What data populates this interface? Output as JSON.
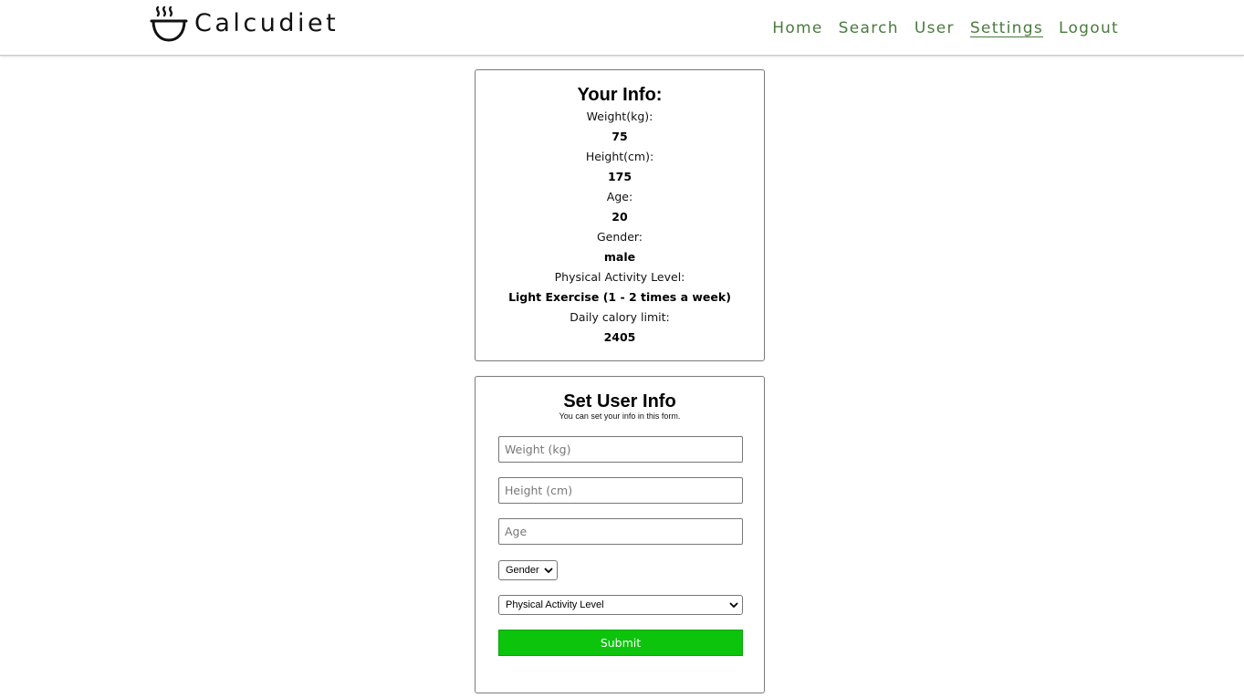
{
  "brand": {
    "name": "Calcudiet",
    "logo_icon": "steaming-bowl-icon"
  },
  "nav": {
    "items": [
      {
        "label": "Home"
      },
      {
        "label": "Search"
      },
      {
        "label": "User"
      },
      {
        "label": "Settings"
      },
      {
        "label": "Logout"
      }
    ],
    "active": "Settings",
    "link_color": "#4a7a3e"
  },
  "info_card": {
    "title": "Your Info:",
    "fields": [
      {
        "label": "Weight(kg):",
        "value": "75"
      },
      {
        "label": "Height(cm):",
        "value": "175"
      },
      {
        "label": "Age:",
        "value": "20"
      },
      {
        "label": "Gender:",
        "value": "male"
      },
      {
        "label": "Physical Activity Level:",
        "value": "Light Exercise (1 - 2 times a week)"
      },
      {
        "label": "Daily calory limit:",
        "value": "2405"
      }
    ]
  },
  "form_card": {
    "title": "Set User Info",
    "subtitle": "You can set your info in this form.",
    "weight_placeholder": "Weight (kg)",
    "height_placeholder": "Height (cm)",
    "age_placeholder": "Age",
    "gender_select": "Gender",
    "activity_select": "Physical Activity Level",
    "submit_label": "Submit",
    "submit_color": "#0bc40b"
  }
}
